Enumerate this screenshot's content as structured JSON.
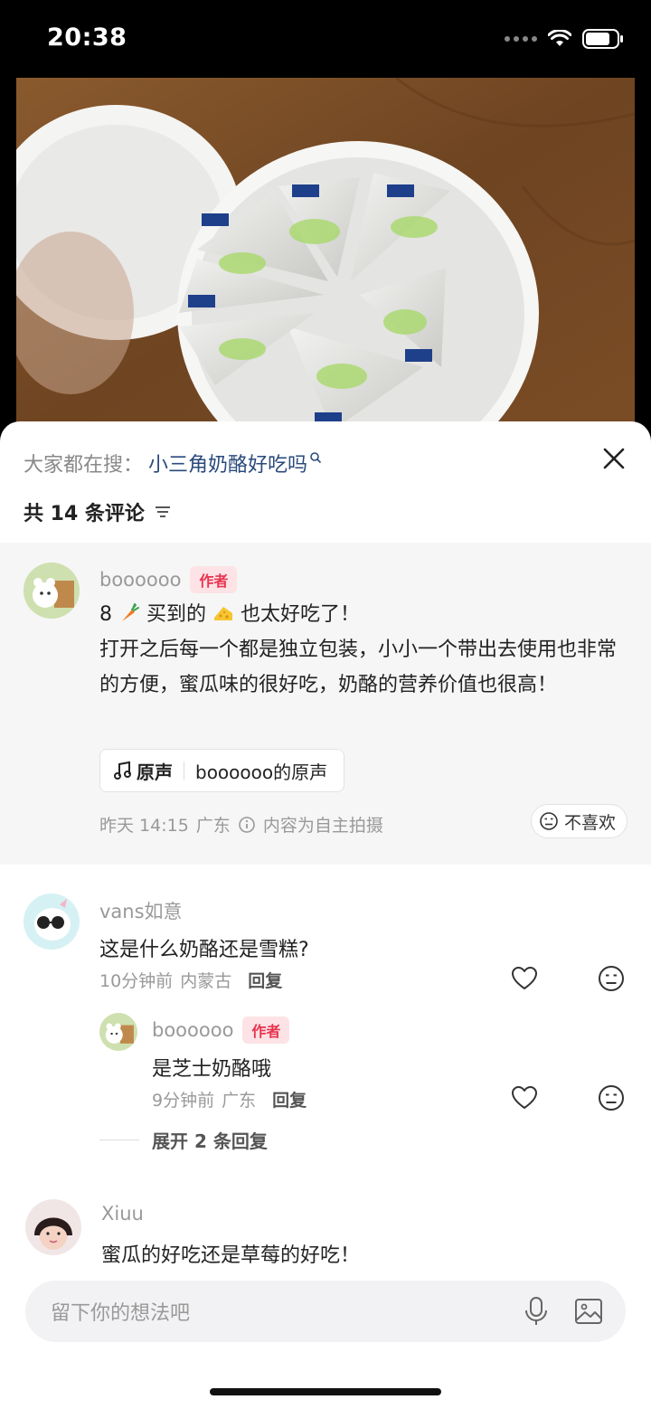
{
  "status_bar": {
    "time": "20:38"
  },
  "panel": {
    "search_prefix": "大家都在搜：",
    "search_term": "小三角奶酪好吃吗",
    "comment_count": "共 14 条评论"
  },
  "author_post": {
    "username": "boooooo",
    "tag": "作者",
    "line1_a": "8",
    "line1_b": "买到的",
    "line1_c": "也太好吃了！",
    "body": "打开之后每一个都是独立包装，小小一个带出去使用也非常的方便，蜜瓜味的很好吃，奶酪的营养价值也很高！",
    "music_label": "原声",
    "music_title": "boooooo的原声",
    "time": "昨天 14:15",
    "location": "广东",
    "notice": "内容为自主拍摄",
    "dislike_label": "不喜欢"
  },
  "comments": [
    {
      "username": "vans如意",
      "text": "这是什么奶酪还是雪糕?",
      "time": "10分钟前",
      "location": "内蒙古",
      "reply_label": "回复",
      "replies": [
        {
          "username": "boooooo",
          "tag": "作者",
          "text": "是芝士奶酪哦",
          "time": "9分钟前",
          "location": "广东",
          "reply_label": "回复"
        }
      ],
      "expand_label": "展开 2 条回复"
    },
    {
      "username": "Xiuu",
      "text": "蜜瓜的好吃还是草莓的好吃！"
    }
  ],
  "input": {
    "placeholder": "留下你的想法吧"
  },
  "colors": {
    "accent": "#e8344f",
    "link": "#2a4a7c",
    "tag_bg": "#fde3e6"
  },
  "icons": [
    "wifi-icon",
    "battery-icon",
    "close-icon",
    "filter-icon",
    "music-note-icon",
    "info-icon",
    "dislike-face-icon",
    "heart-icon",
    "mic-icon",
    "image-icon"
  ]
}
